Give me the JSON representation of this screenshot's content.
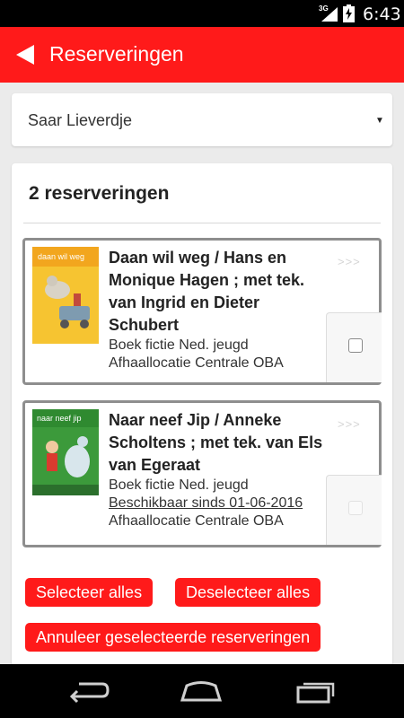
{
  "status_bar": {
    "network": "3G",
    "time": "6:43"
  },
  "app_bar": {
    "title": "Reserveringen",
    "back_icon": "back-arrow-icon"
  },
  "account_selector": {
    "value": "Saar Lieverdje"
  },
  "reservations": {
    "heading": "2 reserveringen",
    "items": [
      {
        "cover_text": "daan wil weg",
        "title": "Daan wil weg / Hans en Monique Hagen ; met tek. van Ingrid en Dieter Schubert",
        "type": "Boek fictie Ned. jeugd",
        "availability": "",
        "location": "Afhaallocatie Centrale OBA",
        "more": ">>>",
        "checked": false,
        "selectable": true
      },
      {
        "cover_text": "naar neef jip",
        "title": "Naar neef Jip / Anneke Scholtens ; met tek. van Els van Egeraat",
        "type": "Boek fictie Ned. jeugd",
        "availability": "Beschikbaar sinds 01-06-2016",
        "location": "Afhaallocatie Centrale OBA",
        "more": ">>>",
        "checked": false,
        "selectable": false
      }
    ]
  },
  "actions": {
    "select_all": "Selecteer alles",
    "deselect_all": "Deselecteer alles",
    "cancel_selected": "Annuleer geselecteerde reserveringen"
  },
  "colors": {
    "accent": "#ff1a1a",
    "background": "#ebebeb",
    "card": "#ffffff"
  }
}
